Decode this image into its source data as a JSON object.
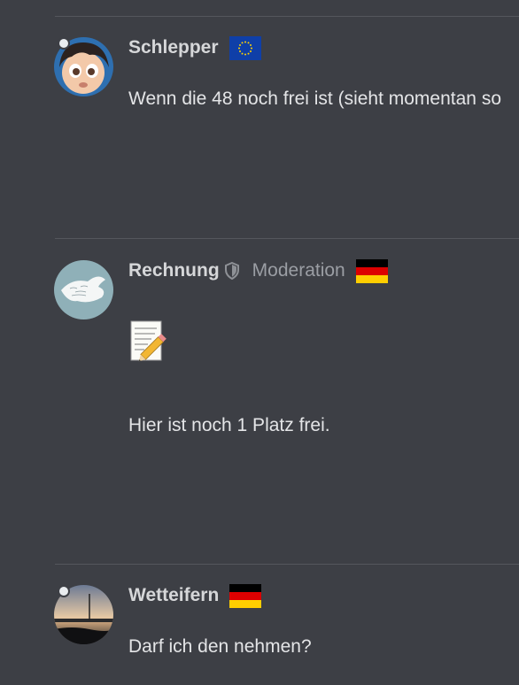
{
  "posts": [
    {
      "username": "Schlepper",
      "avatar": "cartoon-girl-avatar",
      "flag": "eu-flag",
      "online_indicator": true,
      "body": "Wenn die 48 noch frei ist (sieht momentan so"
    },
    {
      "username": "Rechnung",
      "avatar": "peace-dove-avatar",
      "badge_icon": "shield-icon",
      "role": "Moderation",
      "flag": "germany-flag",
      "online_indicator": false,
      "emoji": "memo-pencil-emoji",
      "body": "Hier ist noch 1 Platz frei."
    },
    {
      "username": "Wetteifern",
      "avatar": "sunset-landscape-avatar",
      "flag": "germany-flag",
      "online_indicator": true,
      "body": "Darf ich den nehmen?"
    }
  ],
  "colors": {
    "background": "#3d3f45",
    "divider": "#55575d",
    "username": "#d6d7d9",
    "role": "#9b9ea4",
    "text": "#e4e5e7"
  }
}
